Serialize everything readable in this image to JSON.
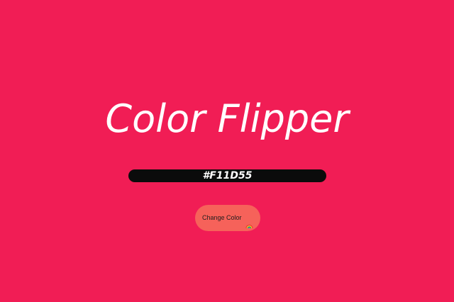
{
  "app": {
    "title": "Color Flipper",
    "current_color": "#F11D55",
    "background_color": "#F11D55",
    "button": {
      "label": "Change Color",
      "icon": "rainbow-icon"
    }
  }
}
